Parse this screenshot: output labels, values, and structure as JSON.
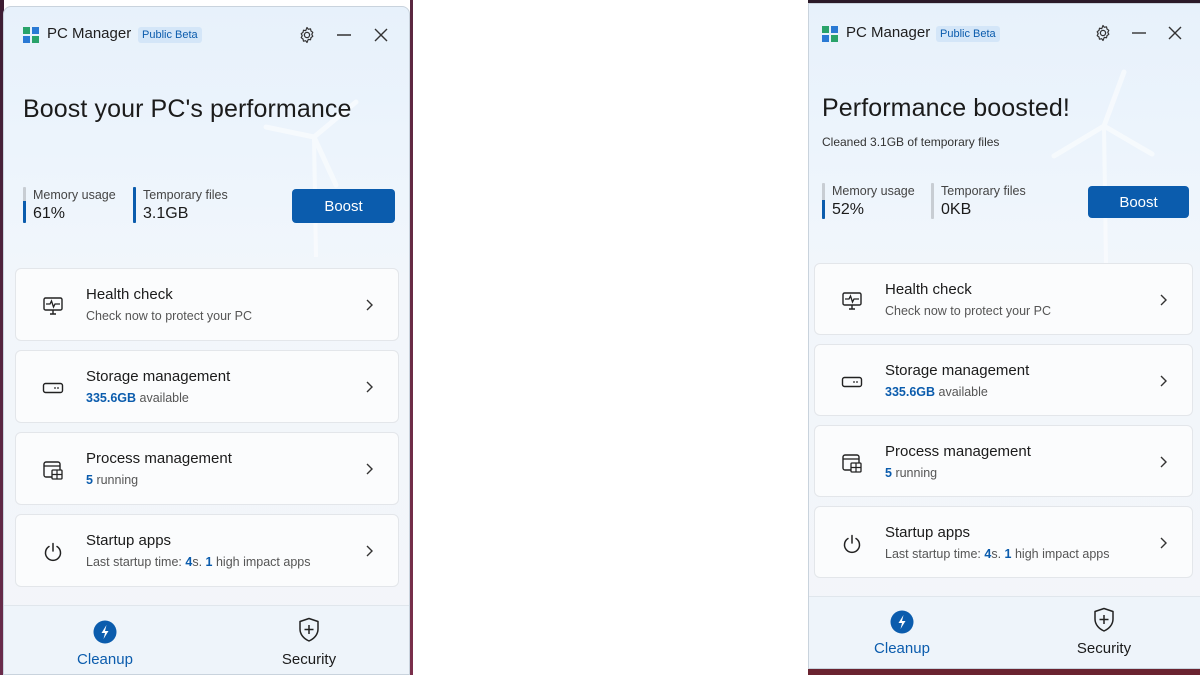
{
  "left_window": {
    "app_title": "PC Manager",
    "beta_badge": "Public Beta",
    "hero_title": "Boost your PC's performance",
    "memory": {
      "label": "Memory usage",
      "value": "61%",
      "level": 0.61
    },
    "temp": {
      "label": "Temporary files",
      "value": "3.1GB",
      "level": 1.0
    },
    "boost_label": "Boost",
    "cards": [
      {
        "title": "Health check",
        "sub_text": "Check now to protect your PC"
      },
      {
        "title": "Storage management",
        "sub_value": "335.6GB",
        "sub_text": "available"
      },
      {
        "title": "Process management",
        "sub_value": "5",
        "sub_text": "running"
      },
      {
        "title": "Startup apps",
        "sub_prefix": "Last startup time:",
        "sub_value1": "4",
        "sub_mid": "s.",
        "sub_value2": "1",
        "sub_suffix": "high impact apps"
      }
    ],
    "nav": {
      "cleanup": "Cleanup",
      "security": "Security"
    }
  },
  "right_window": {
    "app_title": "PC Manager",
    "beta_badge": "Public Beta",
    "hero_title": "Performance boosted!",
    "hero_sub": "Cleaned 3.1GB of temporary files",
    "memory": {
      "label": "Memory usage",
      "value": "52%",
      "level": 0.52
    },
    "temp": {
      "label": "Temporary files",
      "value": "0KB",
      "level": 0.0
    },
    "boost_label": "Boost",
    "cards": [
      {
        "title": "Health check",
        "sub_text": "Check now to protect your PC"
      },
      {
        "title": "Storage management",
        "sub_value": "335.6GB",
        "sub_text": "available"
      },
      {
        "title": "Process management",
        "sub_value": "5",
        "sub_text": "running"
      },
      {
        "title": "Startup apps",
        "sub_prefix": "Last startup time:",
        "sub_value1": "4",
        "sub_mid": "s.",
        "sub_value2": "1",
        "sub_suffix": "high impact apps"
      }
    ],
    "nav": {
      "cleanup": "Cleanup",
      "security": "Security"
    }
  },
  "icons": {
    "logo": "pc-manager-logo-icon",
    "settings": "gear-icon",
    "minimize": "minimize-icon",
    "close": "close-icon",
    "health": "health-monitor-icon",
    "storage": "storage-drive-icon",
    "process": "process-window-icon",
    "startup": "power-icon",
    "chevron": "chevron-right-icon",
    "cleanup": "lightning-icon",
    "security": "shield-plus-icon"
  },
  "colors": {
    "accent": "#0b5cad",
    "badge_bg": "#d4e6f8",
    "window_bg": "#f3f5f9"
  }
}
